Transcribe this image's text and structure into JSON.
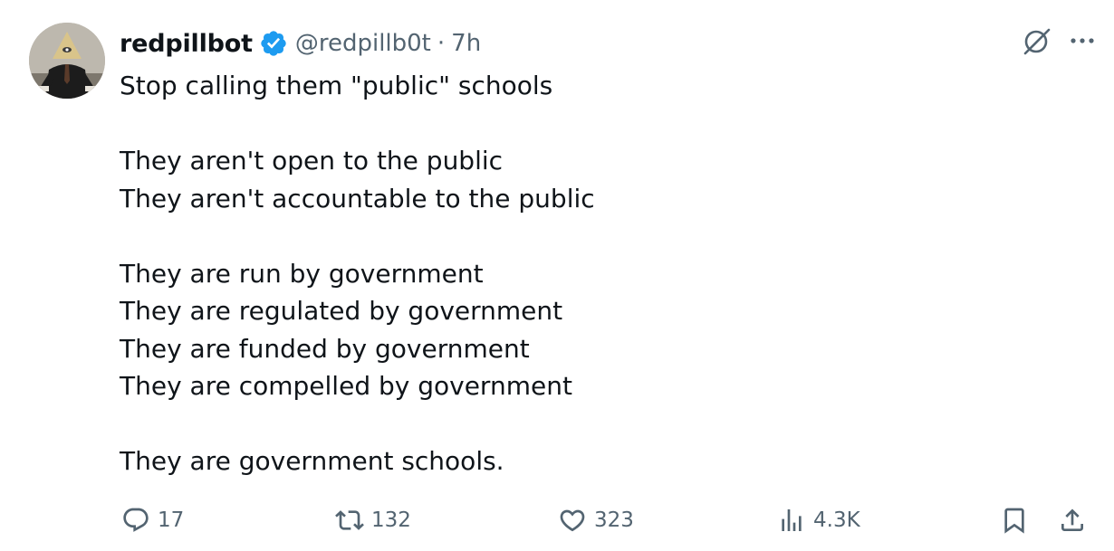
{
  "author": {
    "name": "redpillbot",
    "handle": "@redpillb0t",
    "separator": "·",
    "time": "7h"
  },
  "tweet": {
    "lines": [
      "Stop calling them \"public\" schools",
      "",
      "They aren't open to the public",
      "They aren't accountable to the public",
      "",
      "They are run by government",
      "They are regulated by government",
      "They are funded by government",
      "They are compelled by government",
      "",
      "They are government schools."
    ]
  },
  "metrics": {
    "replies": "17",
    "reposts": "132",
    "likes": "323",
    "views": "4.3K"
  },
  "icons": {
    "verified": "verified-badge-icon",
    "grok": "grok-icon",
    "more": "more-icon",
    "reply": "reply-icon",
    "repost": "repost-icon",
    "like": "heart-icon",
    "views": "views-icon",
    "bookmark": "bookmark-icon",
    "share": "share-icon"
  },
  "colors": {
    "text": "#0f1419",
    "secondary": "#536471",
    "verified": "#1d9bf0"
  }
}
